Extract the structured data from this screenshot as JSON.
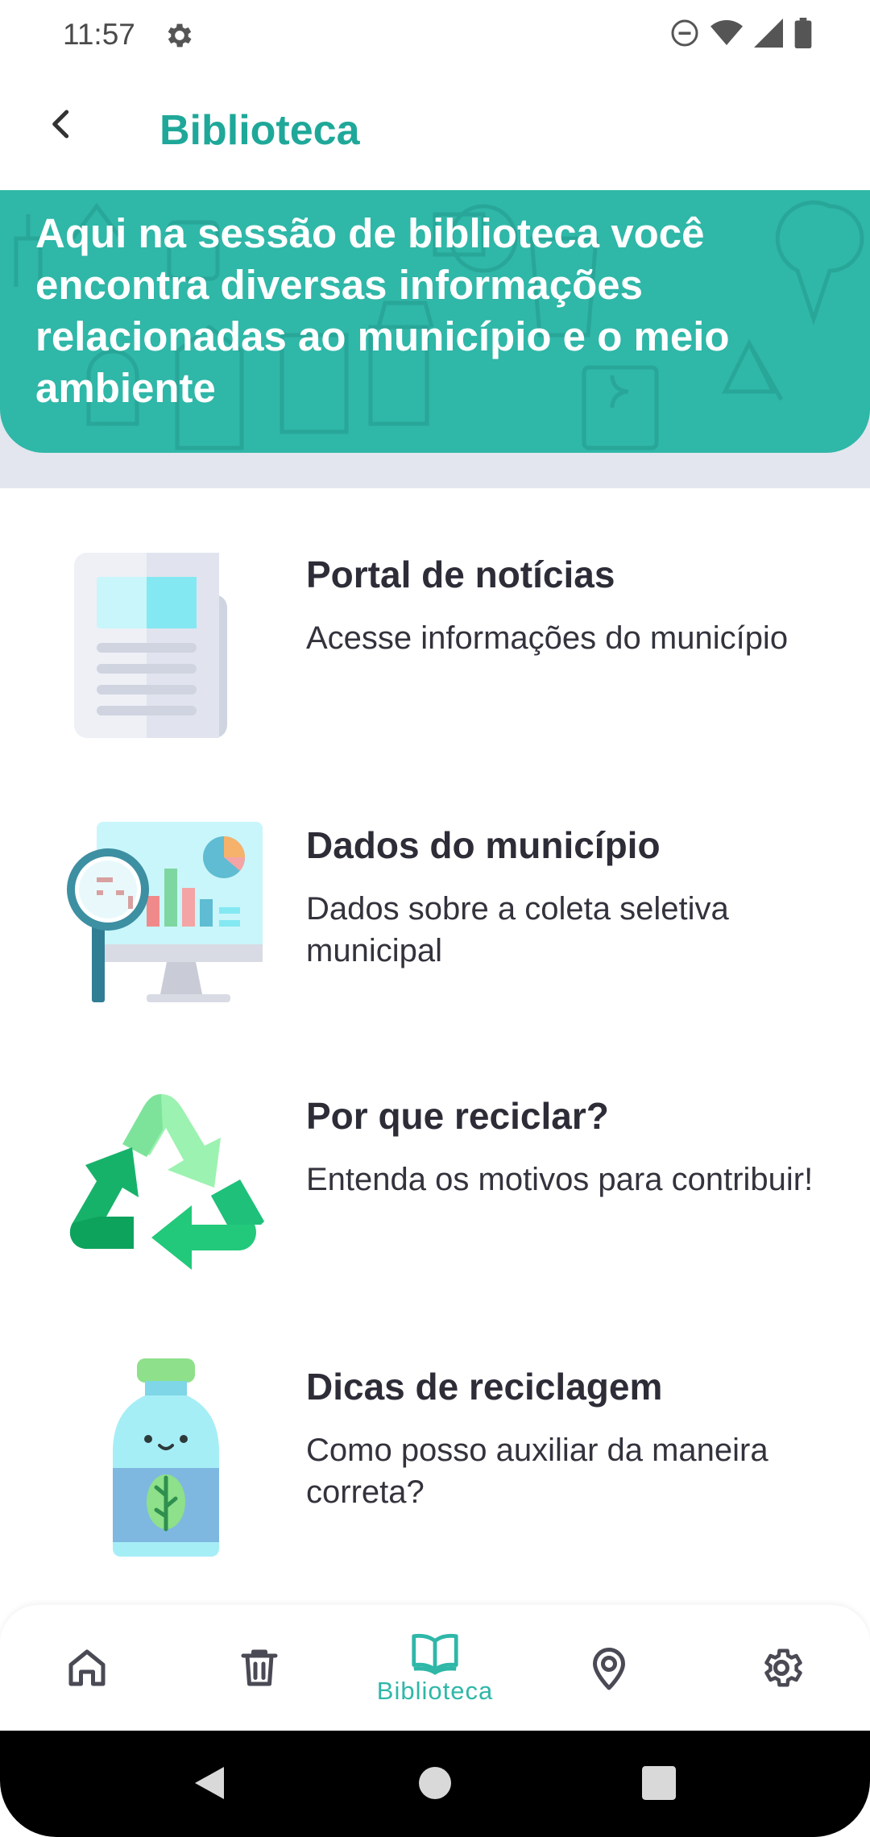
{
  "status_bar": {
    "time": "11:57",
    "icons": [
      "gear-icon",
      "do-not-disturb-icon",
      "wifi-icon",
      "cell-signal-icon",
      "battery-icon"
    ]
  },
  "header": {
    "title": "Biblioteca",
    "back_icon": "chevron-left-icon"
  },
  "banner": {
    "text": "Aqui na sessão de biblioteca você encontra diversas informações relacionadas ao município e o meio ambiente",
    "color": "#2fb7a8"
  },
  "library_items": [
    {
      "title": "Portal de notícias",
      "description": "Acesse informações do município",
      "icon": "newspaper-icon"
    },
    {
      "title": "Dados do município",
      "description": "Dados sobre a coleta seletiva municipal",
      "icon": "data-monitor-icon"
    },
    {
      "title": "Por que reciclar?",
      "description": "Entenda os motivos para contribuir!",
      "icon": "recycle-icon"
    },
    {
      "title": "Dicas de reciclagem",
      "description": "Como posso auxiliar da maneira correta?",
      "icon": "bottle-icon"
    }
  ],
  "bottom_nav": {
    "items": [
      {
        "icon": "home-icon",
        "label": ""
      },
      {
        "icon": "trash-icon",
        "label": ""
      },
      {
        "icon": "book-icon",
        "label": "Biblioteca",
        "active": true
      },
      {
        "icon": "location-pin-icon",
        "label": ""
      },
      {
        "icon": "settings-icon",
        "label": ""
      }
    ],
    "active_color": "#2fb7a8"
  },
  "system_nav": {
    "buttons": [
      "back-triangle-icon",
      "home-circle-icon",
      "recents-square-icon"
    ]
  }
}
